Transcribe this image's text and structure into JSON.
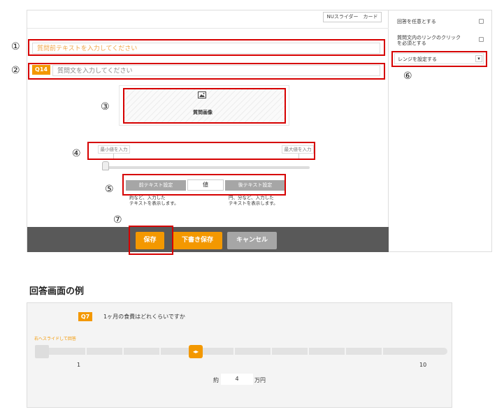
{
  "editor": {
    "tab_label": "NUスライダー　カード",
    "pre_question_placeholder": "質問前テキストを入力してください",
    "question_badge": "Q14",
    "question_placeholder": "質問文を入力してください",
    "image_label": "質問画像",
    "min_placeholder": "最小値を入力",
    "max_placeholder": "最大値を入力",
    "pre_text_btn": "前テキスト設定",
    "value_label": "値",
    "post_text_btn": "後テキスト設定",
    "pre_note": "約など、入力した\nテキストを表示します。",
    "post_note": "円、分など、入力した\nテキストを表示します。",
    "buttons": {
      "save": "保存",
      "draft": "下書き保存",
      "cancel": "キャンセル"
    }
  },
  "side_panel": {
    "optional_label": "回答を任意とする",
    "require_link_label": "質問文内のリンクのクリック\nを必須とする",
    "range_label": "レンジを設定する",
    "dropdown_arrow": "▾"
  },
  "annotations": [
    "①",
    "②",
    "③",
    "④",
    "⑤",
    "⑥",
    "⑦"
  ],
  "example": {
    "title": "回答画面の例",
    "badge": "Q7",
    "question": "1ヶ月の食費はどれくらいですか",
    "slide_hint": "右へスライドして回答",
    "min": "1",
    "max": "10",
    "prefix": "約",
    "value": "4",
    "suffix": "万円",
    "handle_glyph": "◂▸"
  },
  "colors": {
    "accent": "#f39800",
    "annotation": "#d60000",
    "footer": "#595959",
    "cancel": "#a6a6a6"
  }
}
